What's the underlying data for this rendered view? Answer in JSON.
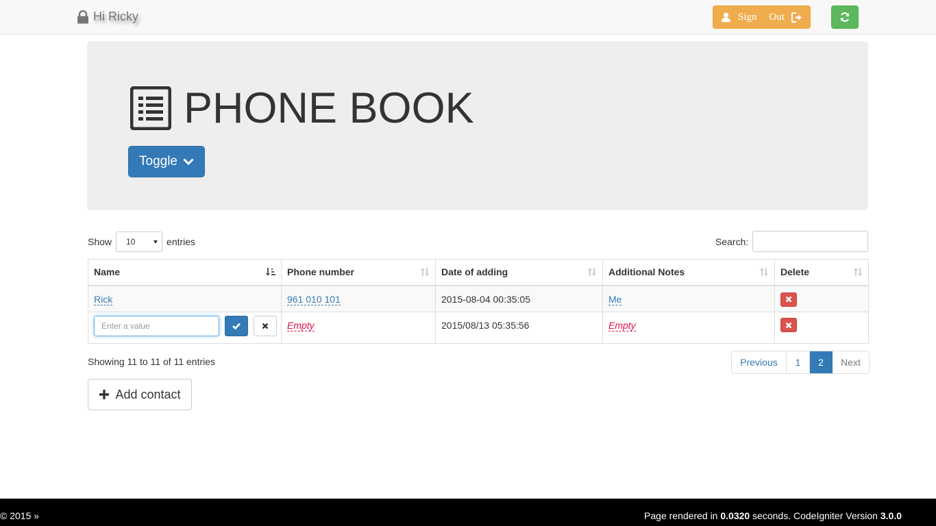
{
  "navbar": {
    "greeting": "Hi Ricky",
    "sign_word": "Sign",
    "out_word": "Out",
    "icons": [
      "lock-icon",
      "user-icon",
      "logout-icon",
      "refresh-icon"
    ]
  },
  "header": {
    "title": "PHONE BOOK",
    "toggle_label": "Toggle"
  },
  "controls": {
    "show_label": "Show",
    "page_size": "10",
    "entries_label": "entries",
    "search_label": "Search:",
    "search_value": ""
  },
  "table": {
    "columns": [
      "Name",
      "Phone number",
      "Date of adding",
      "Additional Notes",
      "Delete"
    ],
    "rows": [
      {
        "name": "Rick",
        "phone": "961 010 101",
        "date": "2015-08-04 00:35:05",
        "notes": "Me"
      },
      {
        "name_placeholder": "Enter a value",
        "phone": "Empty",
        "date": "2015/08/13 05:35:56",
        "notes": "Empty"
      }
    ]
  },
  "footer_table": {
    "info": "Showing 11 to 11 of 11 entries",
    "pager": {
      "prev": "Previous",
      "pages": [
        "1",
        "2"
      ],
      "active": "2",
      "next": "Next"
    }
  },
  "add_button": "Add contact",
  "footer": {
    "left": "© 2015 »",
    "rendered_prefix": "Page rendered in ",
    "rendered_time": "0.0320",
    "rendered_mid": " seconds. CodeIgniter Version ",
    "version": "3.0.0"
  },
  "colors": {
    "primary": "#337ab7",
    "warning": "#f0ad4e",
    "success": "#5cb85c",
    "danger": "#d9534f",
    "empty_text": "#dd1144"
  }
}
